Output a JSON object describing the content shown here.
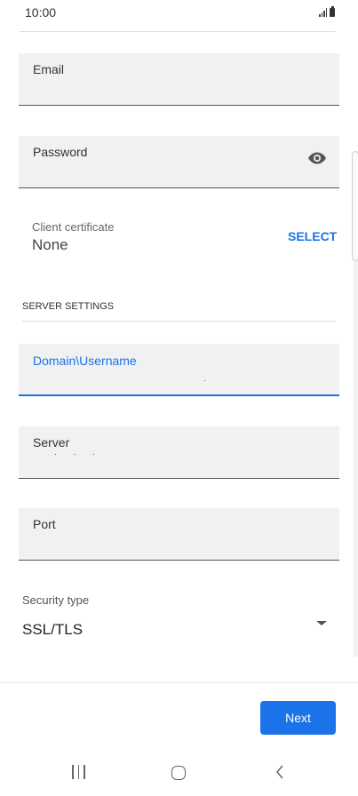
{
  "status_bar": {
    "time": "10:00",
    "signal_icon": "signal-icon",
    "battery_icon": "battery-icon"
  },
  "form": {
    "email": {
      "label": "Email",
      "value": ""
    },
    "password": {
      "label": "Password",
      "value": "",
      "toggle_icon": "eye-icon"
    },
    "client_certificate": {
      "label": "Client certificate",
      "value": "None",
      "action": "SELECT"
    },
    "server_settings": {
      "header": "SERVER SETTINGS",
      "domain_username": {
        "label": "Domain\\Username",
        "value": "."
      },
      "server": {
        "label": "Server",
        "value": ". . ."
      },
      "port": {
        "label": "Port",
        "value": ""
      },
      "security_type": {
        "label": "Security type",
        "value": "SSL/TLS",
        "dropdown_icon": "dropdown-arrow-icon"
      }
    }
  },
  "footer": {
    "next_label": "Next"
  },
  "nav_bar": {
    "recent_icon": "recent-apps-icon",
    "home_icon": "home-icon",
    "back_icon": "back-icon"
  },
  "colors": {
    "accent": "#1a73e8",
    "field_background": "#f1f1f1"
  }
}
